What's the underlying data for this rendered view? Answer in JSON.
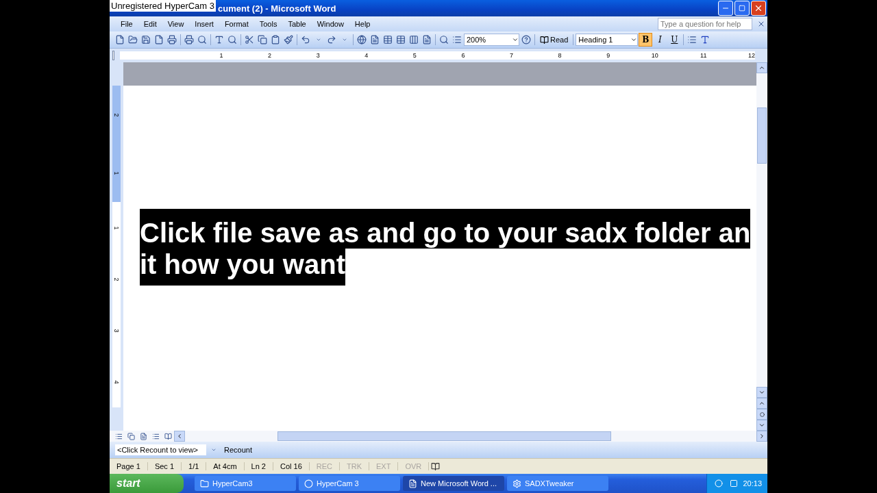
{
  "window": {
    "overlay_title": "Unregistered HyperCam 3",
    "title": "cument (2) - Microsoft Word"
  },
  "menu": [
    "File",
    "Edit",
    "View",
    "Insert",
    "Format",
    "Tools",
    "Table",
    "Window",
    "Help"
  ],
  "help_search": {
    "placeholder": "Type a question for help"
  },
  "toolbar": {
    "zoom": "200%",
    "read": "Read",
    "style": "Heading 1",
    "bold": "B",
    "italic": "I",
    "underline": "U",
    "bold_on": true
  },
  "ruler": [
    "1",
    "2",
    "3",
    "4",
    "5",
    "6",
    "7",
    "8",
    "9",
    "10",
    "11",
    "12"
  ],
  "vertical_ruler": {
    "above": [
      "2",
      "1"
    ],
    "below": [
      "1",
      "2",
      "3",
      "4"
    ]
  },
  "document": {
    "lines": [
      "Click file save as and go to your sadx folder an",
      "it how you want "
    ]
  },
  "recount": {
    "field": "<Click Recount to view>",
    "button": "Recount"
  },
  "status_bar": {
    "fields": [
      {
        "text": "Page 1",
        "disabled": false
      },
      {
        "text": "Sec 1",
        "disabled": false
      },
      {
        "text": "1/1",
        "disabled": false
      },
      {
        "text": "At 4cm",
        "disabled": false
      },
      {
        "text": "Ln 2",
        "disabled": false
      },
      {
        "text": "Col 16",
        "disabled": false
      },
      {
        "text": "REC",
        "disabled": true
      },
      {
        "text": "TRK",
        "disabled": true
      },
      {
        "text": "EXT",
        "disabled": true
      },
      {
        "text": "OVR",
        "disabled": true
      }
    ]
  },
  "taskbar": {
    "start": "start",
    "items": [
      {
        "label": "HyperCam3",
        "kind": "folder",
        "selected": false
      },
      {
        "label": "HyperCam 3",
        "kind": "record",
        "selected": false
      },
      {
        "label": "New Microsoft Word ...",
        "kind": "word",
        "selected": true
      },
      {
        "label": "SADXTweaker",
        "kind": "app",
        "selected": false
      }
    ],
    "clock": "20:13"
  }
}
